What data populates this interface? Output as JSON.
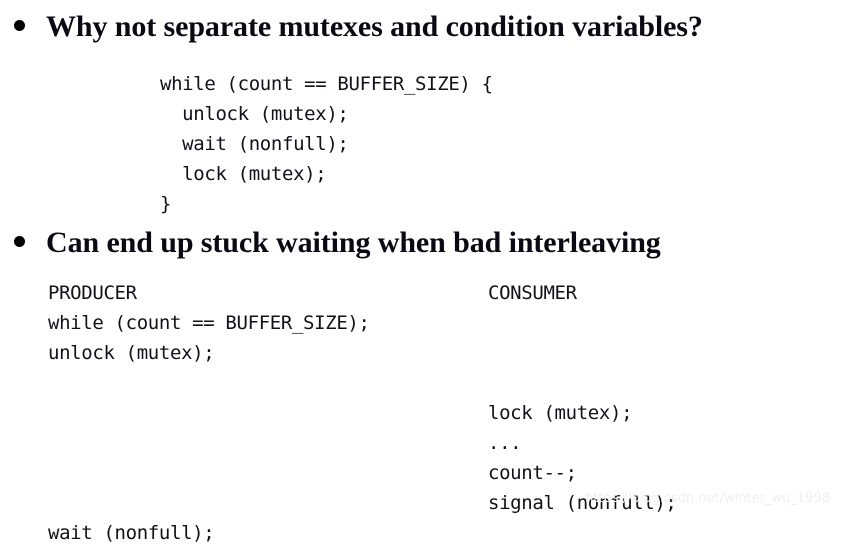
{
  "slide": {
    "background_color": "#ffffff",
    "text_color": "#0a0a14",
    "code_color": "#111119"
  },
  "bullets": [
    {
      "marker": "bullet-dot",
      "text": "Why not separate mutexes and condition variables?"
    },
    {
      "marker": "bullet-dot",
      "text": "Can end up stuck waiting when bad interleaving"
    }
  ],
  "code_primary": {
    "lines": [
      "while (count == BUFFER_SIZE) {",
      "  unlock (mutex);",
      "  wait (nonfull);",
      "  lock (mutex);",
      "}"
    ],
    "text": "while (count == BUFFER_SIZE) {\n  unlock (mutex);\n  wait (nonfull);\n  lock (mutex);\n}"
  },
  "interleaving": {
    "columns": [
      "PRODUCER",
      "CONSUMER"
    ],
    "rows": [
      {
        "producer": "PRODUCER",
        "consumer": "CONSUMER"
      },
      {
        "producer": "while (count == BUFFER_SIZE);",
        "consumer": ""
      },
      {
        "producer": "unlock (mutex);",
        "consumer": ""
      },
      {
        "producer": "",
        "consumer": ""
      },
      {
        "producer": "",
        "consumer": "lock (mutex);"
      },
      {
        "producer": "",
        "consumer": "..."
      },
      {
        "producer": "",
        "consumer": "count--;"
      },
      {
        "producer": "",
        "consumer": "signal (nonfull);"
      },
      {
        "producer": "wait (nonfull);",
        "consumer": ""
      }
    ]
  },
  "watermark": {
    "text": "https://blog.csdn.net/winter_wu_1998",
    "color": "#f0f0f0"
  }
}
